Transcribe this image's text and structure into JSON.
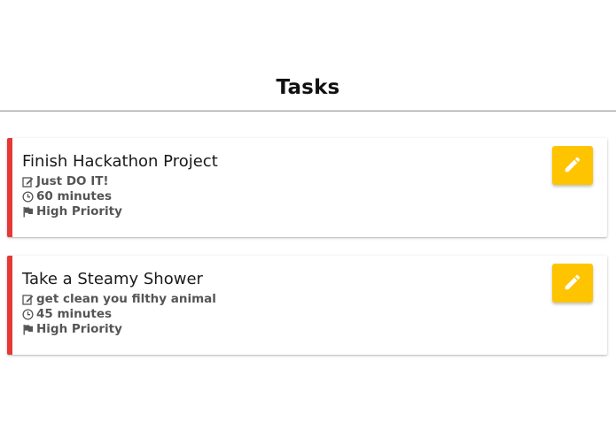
{
  "header": {
    "title": "Tasks"
  },
  "tasks": [
    {
      "title": "Finish Hackathon Project",
      "description": "Just DO IT!",
      "duration": "60 minutes",
      "priority": "High Priority",
      "priority_color": "#e53935",
      "edit_icon": "pencil-icon"
    },
    {
      "title": "Take a Steamy Shower",
      "description": "get clean you filthy animal",
      "duration": "45 minutes",
      "priority": "High Priority",
      "priority_color": "#e53935",
      "edit_icon": "pencil-icon"
    }
  ],
  "colors": {
    "accent_button": "#ffc400",
    "priority_bar": "#e53935",
    "divider": "#8a8a8a"
  }
}
